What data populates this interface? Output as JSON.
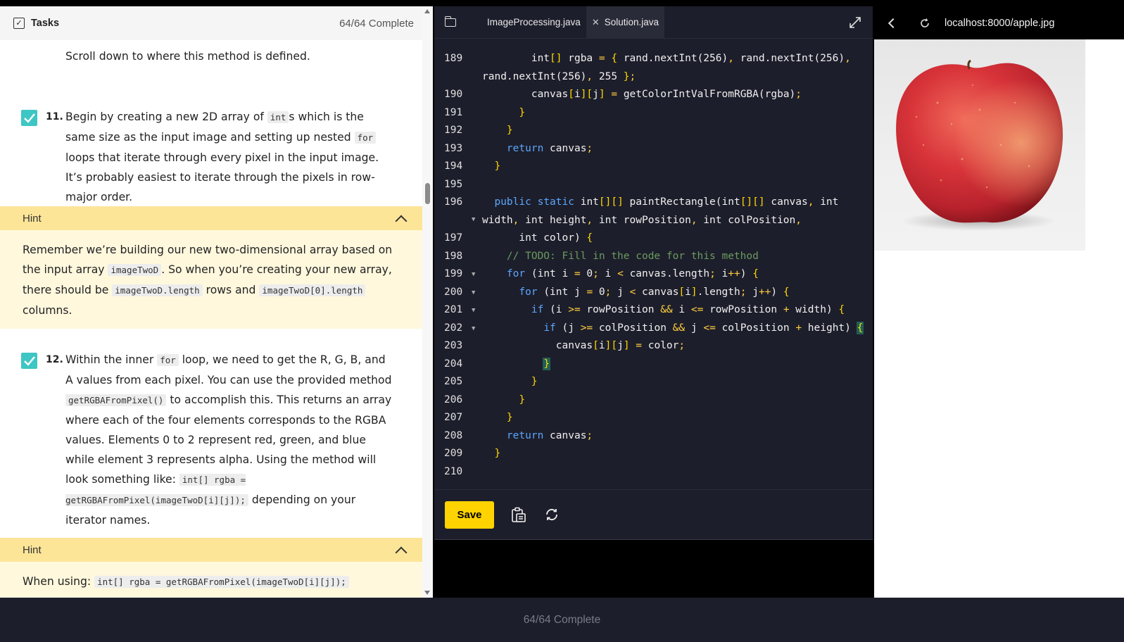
{
  "tasks_panel": {
    "title": "Tasks",
    "progress": "64/64 Complete",
    "intro_line": "Scroll down to where this method is defined.",
    "step11": {
      "number": "11.",
      "t1": "Begin by creating a new 2D array of ",
      "c1": "int",
      "t2": "s which is the same size as the input image and setting up nested ",
      "c2": "for",
      "t3": " loops that iterate through every pixel in the input image. It’s probably easiest to iterate through the pixels in row-major order."
    },
    "hint1": {
      "label": "Hint",
      "t1": "Remember we’re building our new two-dimensional array based on the input array ",
      "c1": "imageTwoD",
      "t2": ". So when you’re creating your new array, there should be ",
      "c2": "imageTwoD.length",
      "t3": " rows and ",
      "c3": "imageTwoD[0].length",
      "t4": " columns."
    },
    "step12": {
      "number": "12.",
      "t1": "Within the inner ",
      "c1": "for",
      "t2": " loop, we need to get the R, G, B, and A values from each pixel. You can use the provided method ",
      "c2": "getRGBAFromPixel()",
      "t3": " to accomplish this. This returns an array where each of the four elements corresponds to the RGBA values. Elements 0 to 2 represent red, green, and blue while element 3 represents alpha. Using the method will look something like: ",
      "c3": "int[] rgba = getRGBAFromPixel(imageTwoD[i][j]);",
      "t4": " depending on your iterator names."
    },
    "hint2": {
      "label": "Hint",
      "t1": "When using: ",
      "c1": "int[] rgba = getRGBAFromPixel(imageTwoD[i][j]);"
    }
  },
  "editor": {
    "tabs": [
      "ImageProcessing.java",
      "Solution.java"
    ],
    "active_tab": "Solution.java",
    "line_numbers": [
      "189",
      "190",
      "191",
      "192",
      "193",
      "194",
      "195",
      "196",
      "197",
      "198",
      "199",
      "200",
      "201",
      "202",
      "203",
      "204",
      "205",
      "206",
      "207",
      "208",
      "209",
      "210"
    ],
    "save_label": "Save"
  },
  "browser": {
    "url": "localhost:8000/apple.jpg",
    "image": "apple"
  },
  "status_bar": {
    "progress": "64/64 Complete"
  },
  "colors": {
    "accent_yellow": "#ffd300",
    "check_teal": "#3ec6c4",
    "hint_bar": "#fde598",
    "hint_body": "#fff8dd",
    "editor_bg": "#1d1e2b",
    "keyword_blue": "#5aa7ff",
    "operator_yellow": "#ffcf3f",
    "comment_green": "#6a9b5e"
  }
}
